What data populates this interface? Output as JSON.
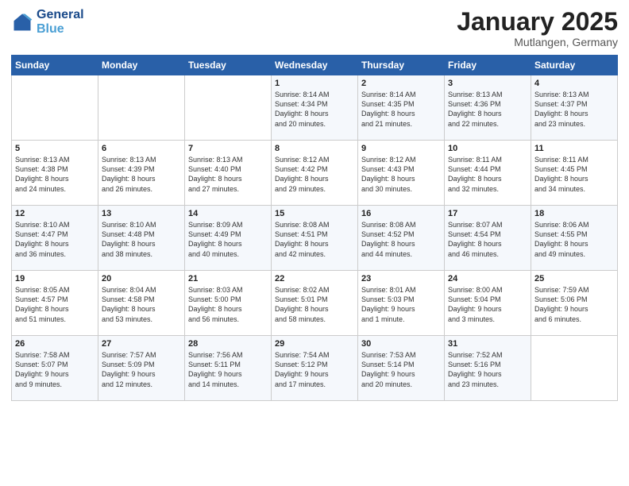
{
  "logo": {
    "line1": "General",
    "line2": "Blue"
  },
  "title": "January 2025",
  "location": "Mutlangen, Germany",
  "days_header": [
    "Sunday",
    "Monday",
    "Tuesday",
    "Wednesday",
    "Thursday",
    "Friday",
    "Saturday"
  ],
  "weeks": [
    [
      {
        "day": "",
        "text": ""
      },
      {
        "day": "",
        "text": ""
      },
      {
        "day": "",
        "text": ""
      },
      {
        "day": "1",
        "text": "Sunrise: 8:14 AM\nSunset: 4:34 PM\nDaylight: 8 hours\nand 20 minutes."
      },
      {
        "day": "2",
        "text": "Sunrise: 8:14 AM\nSunset: 4:35 PM\nDaylight: 8 hours\nand 21 minutes."
      },
      {
        "day": "3",
        "text": "Sunrise: 8:13 AM\nSunset: 4:36 PM\nDaylight: 8 hours\nand 22 minutes."
      },
      {
        "day": "4",
        "text": "Sunrise: 8:13 AM\nSunset: 4:37 PM\nDaylight: 8 hours\nand 23 minutes."
      }
    ],
    [
      {
        "day": "5",
        "text": "Sunrise: 8:13 AM\nSunset: 4:38 PM\nDaylight: 8 hours\nand 24 minutes."
      },
      {
        "day": "6",
        "text": "Sunrise: 8:13 AM\nSunset: 4:39 PM\nDaylight: 8 hours\nand 26 minutes."
      },
      {
        "day": "7",
        "text": "Sunrise: 8:13 AM\nSunset: 4:40 PM\nDaylight: 8 hours\nand 27 minutes."
      },
      {
        "day": "8",
        "text": "Sunrise: 8:12 AM\nSunset: 4:42 PM\nDaylight: 8 hours\nand 29 minutes."
      },
      {
        "day": "9",
        "text": "Sunrise: 8:12 AM\nSunset: 4:43 PM\nDaylight: 8 hours\nand 30 minutes."
      },
      {
        "day": "10",
        "text": "Sunrise: 8:11 AM\nSunset: 4:44 PM\nDaylight: 8 hours\nand 32 minutes."
      },
      {
        "day": "11",
        "text": "Sunrise: 8:11 AM\nSunset: 4:45 PM\nDaylight: 8 hours\nand 34 minutes."
      }
    ],
    [
      {
        "day": "12",
        "text": "Sunrise: 8:10 AM\nSunset: 4:47 PM\nDaylight: 8 hours\nand 36 minutes."
      },
      {
        "day": "13",
        "text": "Sunrise: 8:10 AM\nSunset: 4:48 PM\nDaylight: 8 hours\nand 38 minutes."
      },
      {
        "day": "14",
        "text": "Sunrise: 8:09 AM\nSunset: 4:49 PM\nDaylight: 8 hours\nand 40 minutes."
      },
      {
        "day": "15",
        "text": "Sunrise: 8:08 AM\nSunset: 4:51 PM\nDaylight: 8 hours\nand 42 minutes."
      },
      {
        "day": "16",
        "text": "Sunrise: 8:08 AM\nSunset: 4:52 PM\nDaylight: 8 hours\nand 44 minutes."
      },
      {
        "day": "17",
        "text": "Sunrise: 8:07 AM\nSunset: 4:54 PM\nDaylight: 8 hours\nand 46 minutes."
      },
      {
        "day": "18",
        "text": "Sunrise: 8:06 AM\nSunset: 4:55 PM\nDaylight: 8 hours\nand 49 minutes."
      }
    ],
    [
      {
        "day": "19",
        "text": "Sunrise: 8:05 AM\nSunset: 4:57 PM\nDaylight: 8 hours\nand 51 minutes."
      },
      {
        "day": "20",
        "text": "Sunrise: 8:04 AM\nSunset: 4:58 PM\nDaylight: 8 hours\nand 53 minutes."
      },
      {
        "day": "21",
        "text": "Sunrise: 8:03 AM\nSunset: 5:00 PM\nDaylight: 8 hours\nand 56 minutes."
      },
      {
        "day": "22",
        "text": "Sunrise: 8:02 AM\nSunset: 5:01 PM\nDaylight: 8 hours\nand 58 minutes."
      },
      {
        "day": "23",
        "text": "Sunrise: 8:01 AM\nSunset: 5:03 PM\nDaylight: 9 hours\nand 1 minute."
      },
      {
        "day": "24",
        "text": "Sunrise: 8:00 AM\nSunset: 5:04 PM\nDaylight: 9 hours\nand 3 minutes."
      },
      {
        "day": "25",
        "text": "Sunrise: 7:59 AM\nSunset: 5:06 PM\nDaylight: 9 hours\nand 6 minutes."
      }
    ],
    [
      {
        "day": "26",
        "text": "Sunrise: 7:58 AM\nSunset: 5:07 PM\nDaylight: 9 hours\nand 9 minutes."
      },
      {
        "day": "27",
        "text": "Sunrise: 7:57 AM\nSunset: 5:09 PM\nDaylight: 9 hours\nand 12 minutes."
      },
      {
        "day": "28",
        "text": "Sunrise: 7:56 AM\nSunset: 5:11 PM\nDaylight: 9 hours\nand 14 minutes."
      },
      {
        "day": "29",
        "text": "Sunrise: 7:54 AM\nSunset: 5:12 PM\nDaylight: 9 hours\nand 17 minutes."
      },
      {
        "day": "30",
        "text": "Sunrise: 7:53 AM\nSunset: 5:14 PM\nDaylight: 9 hours\nand 20 minutes."
      },
      {
        "day": "31",
        "text": "Sunrise: 7:52 AM\nSunset: 5:16 PM\nDaylight: 9 hours\nand 23 minutes."
      },
      {
        "day": "",
        "text": ""
      }
    ]
  ]
}
